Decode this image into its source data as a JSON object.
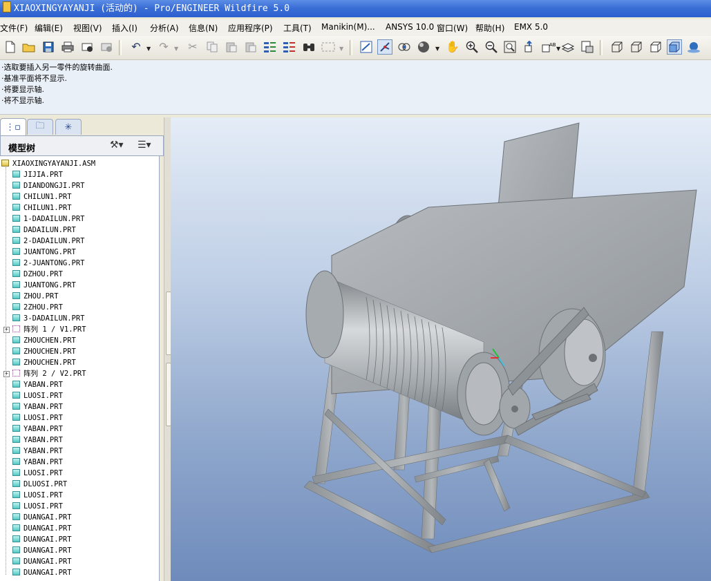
{
  "window": {
    "title": "XIAOXINGYAYANJI (活动的) - Pro/ENGINEER Wildfire 5.0"
  },
  "menu": [
    {
      "label": "文件(F)"
    },
    {
      "label": "编辑(E)"
    },
    {
      "label": "视图(V)"
    },
    {
      "label": "插入(I)"
    },
    {
      "label": "分析(A)"
    },
    {
      "label": "信息(N)"
    },
    {
      "label": "应用程序(P)"
    },
    {
      "label": "工具(T)"
    },
    {
      "label": "Manikin(M)..."
    },
    {
      "label": "ANSYS 10.0"
    },
    {
      "label": "窗口(W)"
    },
    {
      "label": "帮助(H)"
    },
    {
      "label": "EMX 5.0"
    }
  ],
  "toolbar_icons": [
    "new-icon",
    "open-icon",
    "save-icon",
    "print-icon",
    "email-icon",
    "email-link-icon",
    "undo-icon",
    "redo-icon",
    "cut-icon",
    "copy-icon",
    "paste-icon",
    "paste-special-icon",
    "regenerate-icon",
    "regen-manager-icon",
    "find-icon",
    "select-box-icon",
    "repaint-icon",
    "spin-center-icon",
    "orient-mode-icon",
    "appearance-icon",
    "pan-icon",
    "zoom-in-icon",
    "zoom-out-icon",
    "refit-icon",
    "reorient-icon",
    "saved-views-icon",
    "layers-icon",
    "view-manager-icon",
    "wireframe-icon",
    "hidden-line-icon",
    "no-hidden-icon",
    "shading-icon",
    "enhanced-realism-icon"
  ],
  "messages": [
    "·选取要插入另一零件的旋转曲面.",
    "·基准平面将不显示.",
    "·将要显示轴.",
    "·将不显示轴."
  ],
  "model_tree": {
    "title": "模型树",
    "root": "XIAOXINGYAYANJI.ASM",
    "items": [
      {
        "label": "JIJIA.PRT",
        "kind": "part"
      },
      {
        "label": "DIANDONGJI.PRT",
        "kind": "part"
      },
      {
        "label": "CHILUN1.PRT",
        "kind": "part"
      },
      {
        "label": "CHILUN1.PRT",
        "kind": "part"
      },
      {
        "label": "1-DADAILUN.PRT",
        "kind": "part"
      },
      {
        "label": "DADAILUN.PRT",
        "kind": "part"
      },
      {
        "label": "2-DADAILUN.PRT",
        "kind": "part"
      },
      {
        "label": "JUANTONG.PRT",
        "kind": "part"
      },
      {
        "label": "2-JUANTONG.PRT",
        "kind": "part"
      },
      {
        "label": "DZHOU.PRT",
        "kind": "part"
      },
      {
        "label": "JUANTONG.PRT",
        "kind": "part"
      },
      {
        "label": "ZHOU.PRT",
        "kind": "part"
      },
      {
        "label": "2ZHOU.PRT",
        "kind": "part"
      },
      {
        "label": "3-DADAILUN.PRT",
        "kind": "part"
      },
      {
        "label": "阵列 1 / V1.PRT",
        "kind": "pattern"
      },
      {
        "label": "ZHOUCHEN.PRT",
        "kind": "part"
      },
      {
        "label": "ZHOUCHEN.PRT",
        "kind": "part"
      },
      {
        "label": "ZHOUCHEN.PRT",
        "kind": "part"
      },
      {
        "label": "阵列 2 / V2.PRT",
        "kind": "pattern"
      },
      {
        "label": "YABAN.PRT",
        "kind": "part"
      },
      {
        "label": "LUOSI.PRT",
        "kind": "part"
      },
      {
        "label": "YABAN.PRT",
        "kind": "part"
      },
      {
        "label": "LUOSI.PRT",
        "kind": "part"
      },
      {
        "label": "YABAN.PRT",
        "kind": "part"
      },
      {
        "label": "YABAN.PRT",
        "kind": "part"
      },
      {
        "label": "YABAN.PRT",
        "kind": "part"
      },
      {
        "label": "YABAN.PRT",
        "kind": "part"
      },
      {
        "label": "LUOSI.PRT",
        "kind": "part"
      },
      {
        "label": "DLUOSI.PRT",
        "kind": "part"
      },
      {
        "label": "LUOSI.PRT",
        "kind": "part"
      },
      {
        "label": "LUOSI.PRT",
        "kind": "part"
      },
      {
        "label": "DUANGAI.PRT",
        "kind": "part"
      },
      {
        "label": "DUANGAI.PRT",
        "kind": "part"
      },
      {
        "label": "DUANGAI.PRT",
        "kind": "part"
      },
      {
        "label": "DUANGAI.PRT",
        "kind": "part"
      },
      {
        "label": "DUANGAI.PRT",
        "kind": "part"
      },
      {
        "label": "DUANGAI.PRT",
        "kind": "part"
      }
    ]
  },
  "colors": {
    "titlebar": "#3b6fd6",
    "viewport_top": "#e4ecf7",
    "viewport_bottom": "#6e8bbb",
    "model_gray": "#a9adb1"
  }
}
